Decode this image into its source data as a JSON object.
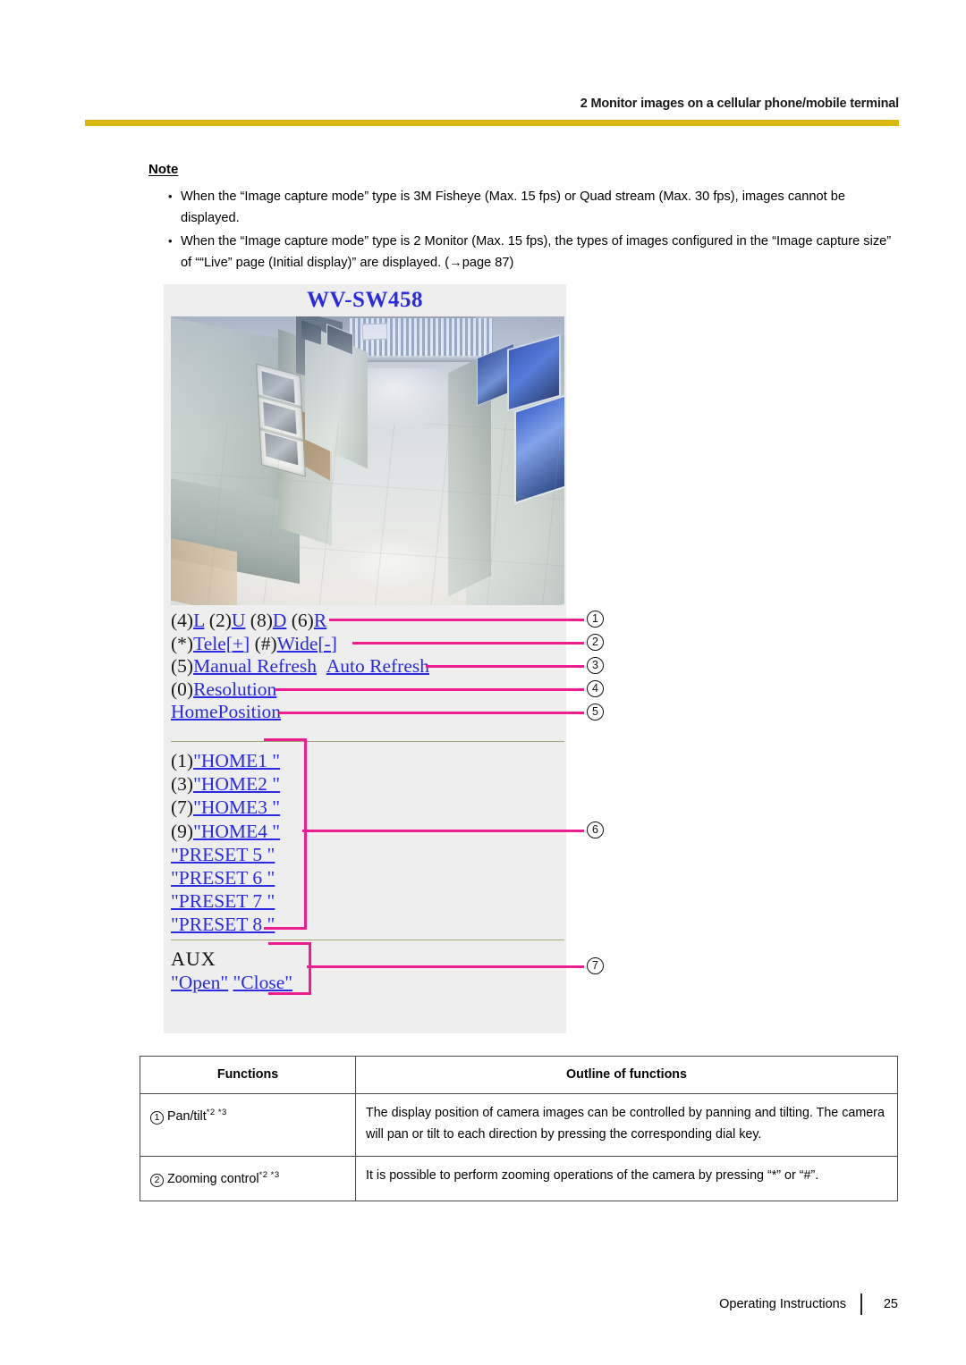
{
  "header": {
    "section_title": "2 Monitor images on a cellular phone/mobile terminal",
    "rule_color": "#d8b80c"
  },
  "note": {
    "title": "Note",
    "bullet_glyph": "•",
    "items": [
      "When the “Image capture mode” type is 3M Fisheye (Max. 15 fps) or Quad stream (Max. 30 fps), images cannot be displayed.",
      "When the “Image capture mode” type is 2 Monitor (Max. 15 fps), the types of images configured in the “Image capture size” of ““Live” page (Initial display)” are displayed. (→page 87)"
    ]
  },
  "phone_screen": {
    "model_title": "WV-SW458",
    "link_color": "#2a2ae0",
    "background": "#eeeeee",
    "camera_image_alt": "Live camera view of an indoor office corridor with white tile floor, gray-green cabinets and blue monitors",
    "pan_tilt_row": {
      "items": [
        {
          "key": "(4)",
          "label": "L"
        },
        {
          "key": "(2)",
          "label": "U"
        },
        {
          "key": "(8)",
          "label": "D"
        },
        {
          "key": "(6)",
          "label": "R"
        }
      ]
    },
    "zoom_row": {
      "items": [
        {
          "key": "(*)",
          "label": "Tele[+]"
        },
        {
          "key": "(#)",
          "label": "Wide[-]"
        }
      ]
    },
    "refresh_row": {
      "items": [
        {
          "key": "(5)",
          "label": "Manual Refresh"
        },
        {
          "key": "",
          "label": "Auto Refresh"
        }
      ]
    },
    "resolution_row": {
      "items": [
        {
          "key": "(0)",
          "label": "Resolution"
        }
      ]
    },
    "home_position_row": {
      "items": [
        {
          "key": "",
          "label": "HomePosition"
        }
      ]
    },
    "preset_rows": [
      {
        "key": "(1)",
        "label": "\"HOME1 \""
      },
      {
        "key": "(3)",
        "label": "\"HOME2 \""
      },
      {
        "key": "(7)",
        "label": "\"HOME3 \""
      },
      {
        "key": "(9)",
        "label": "\"HOME4 \""
      },
      {
        "key": "",
        "label": "\"PRESET 5 \""
      },
      {
        "key": "",
        "label": "\"PRESET 6 \""
      },
      {
        "key": "",
        "label": "\"PRESET 7 \""
      },
      {
        "key": "",
        "label": "\"PRESET 8 \""
      }
    ],
    "aux": {
      "label": "AUX",
      "open": "\"Open\"",
      "close": "\"Close\""
    }
  },
  "callouts": {
    "color": "#ee1d8f",
    "numbers": [
      "①",
      "②",
      "③",
      "④",
      "⑤",
      "⑥",
      "⑦"
    ],
    "plain": [
      "1",
      "2",
      "3",
      "4",
      "5",
      "6",
      "7"
    ]
  },
  "functions_table": {
    "headers": [
      "Functions",
      "Outline of functions"
    ],
    "rows": [
      {
        "num": "1",
        "name": "Pan/tilt",
        "footnotes": "*2 *3",
        "outline": "The display position of camera images can be controlled by panning and tilting. The camera will pan or tilt to each direction by pressing the corresponding dial key."
      },
      {
        "num": "2",
        "name": "Zooming control",
        "footnotes": "*2 *3",
        "outline": "It is possible to perform zooming operations of the camera by pressing “*” or “#”."
      }
    ]
  },
  "footer": {
    "label": "Operating Instructions",
    "page": "25"
  }
}
